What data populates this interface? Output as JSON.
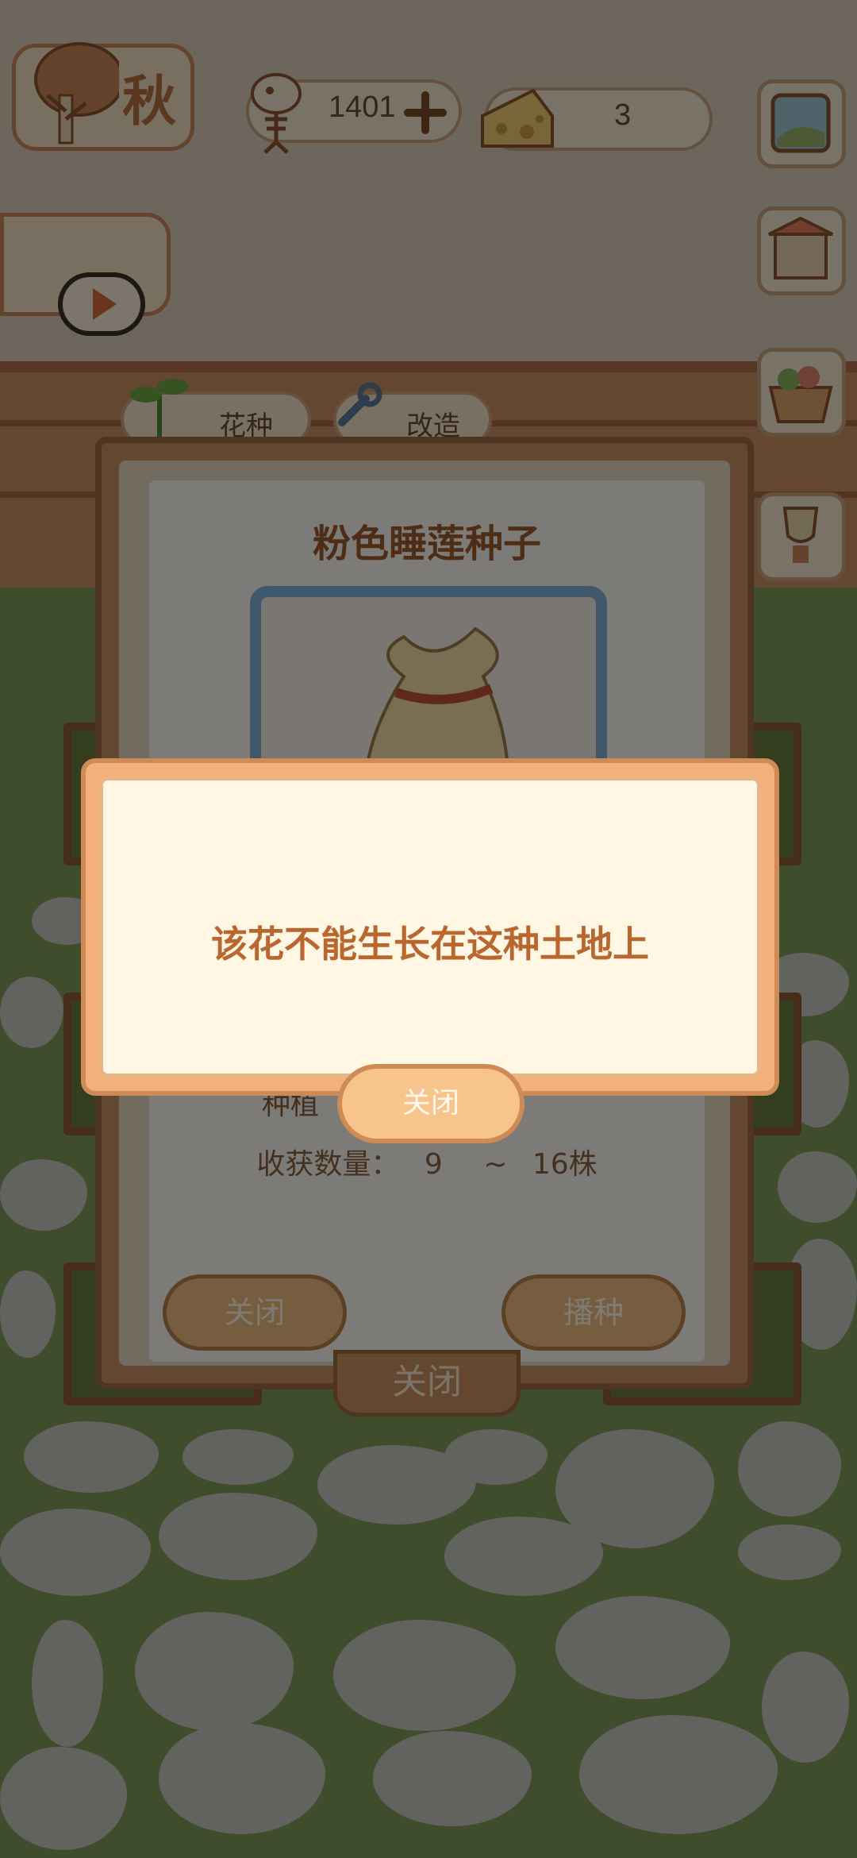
{
  "hud": {
    "season": "秋",
    "fish_count": "1401",
    "cheese_count": "3"
  },
  "tabs": [
    {
      "label": "花种"
    },
    {
      "label": "改造"
    }
  ],
  "seed_panel": {
    "title": "粉色睡莲种子",
    "partial_label": "种植",
    "harvest_label": "收获数量：",
    "harvest_min": "9",
    "harvest_sep": "~",
    "harvest_max": "16株",
    "close_label": "关闭",
    "sow_label": "播种",
    "bottom_close_label": "关闭"
  },
  "dialog": {
    "message": "该花不能生长在这种土地上",
    "close_label": "关闭"
  },
  "icons": [
    "fish-bone-icon",
    "plus-icon",
    "cheese-icon",
    "window-icon",
    "shop-stall-icon",
    "basket-icon",
    "trophy-icon",
    "play-icon",
    "sprout-icon",
    "wrench-icon",
    "seed-bag-icon"
  ],
  "colors": {
    "dialog_text": "#b9672e",
    "button_fill": "#f7c48c",
    "seed_card_border": "#7fb1d9"
  }
}
